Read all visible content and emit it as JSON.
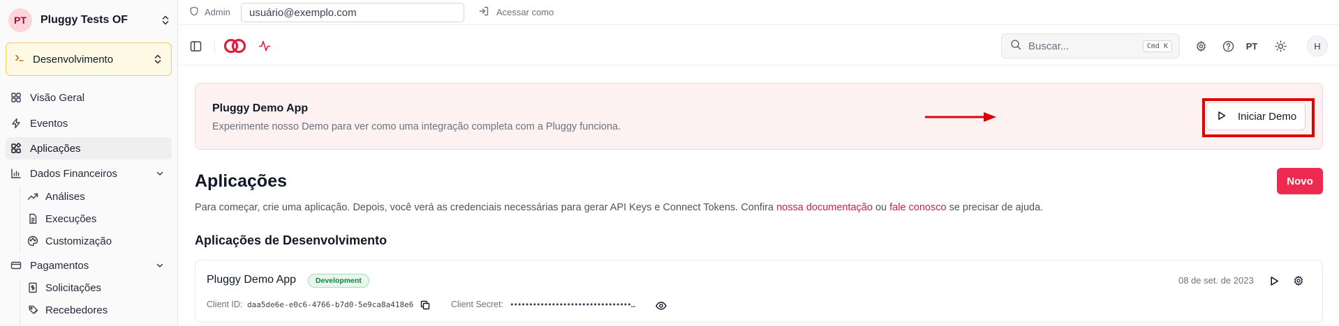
{
  "sidebar": {
    "org": {
      "initials": "PT",
      "name": "Pluggy Tests OF"
    },
    "environment": {
      "label": "Desenvolvimento"
    },
    "nav": {
      "overview": "Visão Geral",
      "events": "Eventos",
      "apps": "Aplicações",
      "financial": "Dados Financeiros",
      "analyses": "Análises",
      "executions": "Execuções",
      "customization": "Customização",
      "payments": "Pagamentos",
      "requests": "Solicitações",
      "recipients": "Recebedores"
    }
  },
  "adminbar": {
    "admin_label": "Admin",
    "user_placeholder": "usuário@exemplo.com",
    "access_label": "Acessar como"
  },
  "toolbar": {
    "search_placeholder": "Buscar...",
    "search_shortcut": "Cmd K",
    "language": "PT",
    "user_initial": "H"
  },
  "banner": {
    "title": "Pluggy Demo App",
    "description": "Experimente nosso Demo para ver como uma integração completa com a Pluggy funciona.",
    "button_label": "Iniciar Demo"
  },
  "main": {
    "title": "Aplicações",
    "new_button": "Novo",
    "intro_prefix": "Para começar, crie uma aplicação. Depois, você verá as credenciais necessárias para gerar API Keys e Connect Tokens. Confira ",
    "intro_link_docs": "nossa documentação",
    "intro_middle": " ou ",
    "intro_link_contact": "fale conosco",
    "intro_suffix": " se precisar de ajuda.",
    "section_title": "Aplicações de Desenvolvimento"
  },
  "app_card": {
    "name": "Pluggy Demo App",
    "badge": "Development",
    "date": "08 de set. de 2023",
    "client_id_label": "Client ID:",
    "client_id": "daa5de6e-e0c6-4766-b7d0-5e9ca8a418e6",
    "client_secret_label": "Client Secret:",
    "client_secret": "••••••••••••••••••••••••••••••••…"
  },
  "colors": {
    "brand": "#ef2a50",
    "link": "#d81b47",
    "env_bg": "#fef9e4",
    "banner_bg": "#fdf1f2",
    "annotation": "#e00000"
  },
  "icons": {
    "org": "chevrons-up-down-icon",
    "env": "terminal-icon",
    "overview": "grid-icon",
    "events": "zap-icon",
    "apps": "apps-icon",
    "financial": "bar-chart-icon",
    "analyses": "trending-up-icon",
    "executions": "file-text-icon",
    "customization": "palette-icon",
    "payments": "credit-card-icon",
    "requests": "receipt-icon",
    "recipients": "users-icon"
  }
}
